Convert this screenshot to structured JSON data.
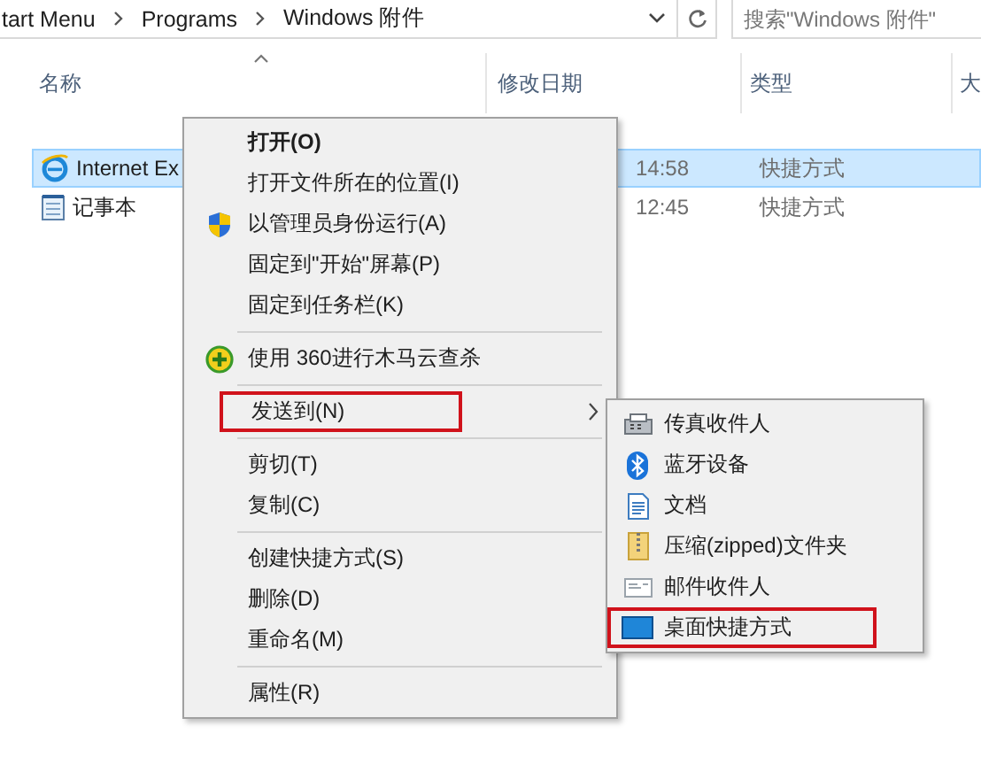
{
  "address_bar": {
    "path": [
      "tart Menu",
      "Programs",
      "Windows 附件"
    ]
  },
  "search": {
    "placeholder": "搜索\"Windows 附件\""
  },
  "columns": [
    "名称",
    "修改日期",
    "类型",
    "大"
  ],
  "files": [
    {
      "name": "Internet Ex",
      "date": "14:58",
      "type": "快捷方式",
      "selected": true
    },
    {
      "name": "记事本",
      "date": "12:45",
      "type": "快捷方式",
      "selected": false
    }
  ],
  "context_menu": {
    "groups": [
      [
        {
          "label": "打开(O)",
          "default": true,
          "highlighted": false,
          "has_submenu": false
        },
        {
          "label": "打开文件所在的位置(I)",
          "default": false,
          "highlighted": false,
          "has_submenu": false
        },
        {
          "label": "以管理员身份运行(A)",
          "default": false,
          "highlighted": false,
          "has_submenu": false
        },
        {
          "label": "固定到\"开始\"屏幕(P)",
          "default": false,
          "highlighted": false,
          "has_submenu": false
        },
        {
          "label": "固定到任务栏(K)",
          "default": false,
          "highlighted": false,
          "has_submenu": false
        }
      ],
      [
        {
          "label": "使用 360进行木马云查杀",
          "default": false,
          "highlighted": false,
          "has_submenu": false
        }
      ],
      [
        {
          "label": "发送到(N)",
          "default": false,
          "highlighted": true,
          "has_submenu": true
        }
      ],
      [
        {
          "label": "剪切(T)",
          "default": false,
          "highlighted": false,
          "has_submenu": false
        },
        {
          "label": "复制(C)",
          "default": false,
          "highlighted": false,
          "has_submenu": false
        }
      ],
      [
        {
          "label": "创建快捷方式(S)",
          "default": false,
          "highlighted": false,
          "has_submenu": false
        },
        {
          "label": "删除(D)",
          "default": false,
          "highlighted": false,
          "has_submenu": false
        },
        {
          "label": "重命名(M)",
          "default": false,
          "highlighted": false,
          "has_submenu": false
        }
      ],
      [
        {
          "label": "属性(R)",
          "default": false,
          "highlighted": false,
          "has_submenu": false
        }
      ]
    ]
  },
  "send_to_menu": [
    {
      "label": "传真收件人",
      "highlighted": false
    },
    {
      "label": "蓝牙设备",
      "highlighted": false
    },
    {
      "label": "文档",
      "highlighted": false
    },
    {
      "label": "压缩(zipped)文件夹",
      "highlighted": false
    },
    {
      "label": "邮件收件人",
      "highlighted": false
    },
    {
      "label": "桌面快捷方式",
      "highlighted": true
    }
  ]
}
